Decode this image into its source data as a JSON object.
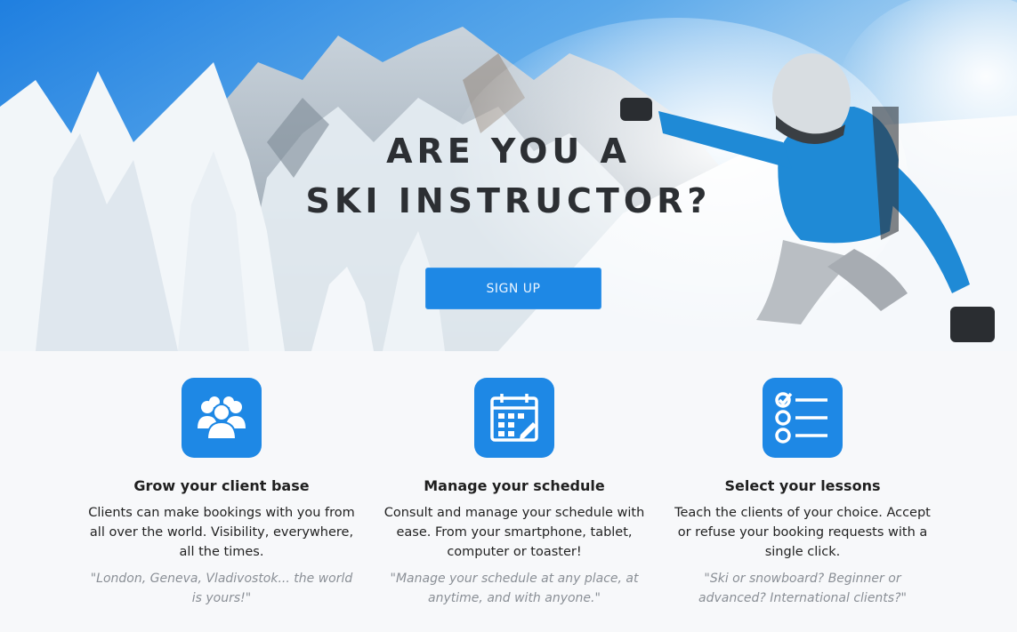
{
  "hero": {
    "title_line1": "ARE YOU A",
    "title_line2": "SKI INSTRUCTOR?",
    "signup_label": "SIGN UP"
  },
  "features": [
    {
      "icon": "users-group-icon",
      "title": "Grow your client base",
      "description": "Clients can make bookings with you from all over the world. Visibility, everywhere, all the times.",
      "quote": "\"London, Geneva, Vladivostok... the world is yours!\""
    },
    {
      "icon": "calendar-icon",
      "title": "Manage your schedule",
      "description": "Consult and manage your schedule with ease. From your smartphone, tablet, computer or toaster!",
      "quote": "\"Manage your schedule at any place, at anytime, and with anyone.\""
    },
    {
      "icon": "checklist-icon",
      "title": "Select your lessons",
      "description": "Teach the clients of your choice. Accept or refuse your booking requests with a single click.",
      "quote": "\"Ski or snowboard? Beginner or advanced? International clients?\""
    }
  ],
  "colors": {
    "accent": "#1e88e5",
    "sky": "#2f86dc",
    "title_text": "#2c2f33",
    "quote_text": "#8a8f96"
  }
}
